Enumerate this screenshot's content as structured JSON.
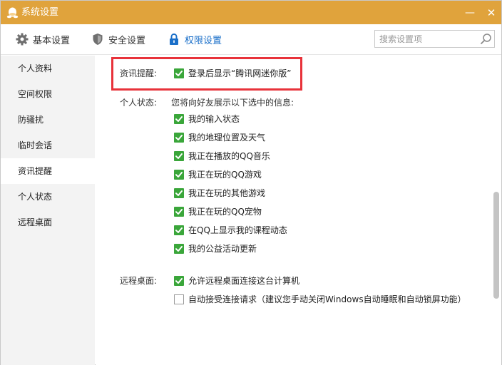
{
  "window": {
    "title": "系统设置",
    "minimize_symbol": "—",
    "close_symbol": "✕"
  },
  "toolbar": {
    "tabs": [
      {
        "label": "基本设置",
        "icon": "gear-icon",
        "active": false
      },
      {
        "label": "安全设置",
        "icon": "shield-icon",
        "active": false
      },
      {
        "label": "权限设置",
        "icon": "lock-icon",
        "active": true
      }
    ],
    "search_placeholder": "搜索设置项",
    "accent_color": "#1a6fc9"
  },
  "sidebar": {
    "items": [
      {
        "label": "个人资料",
        "active": false
      },
      {
        "label": "空间权限",
        "active": false
      },
      {
        "label": "防骚扰",
        "active": false
      },
      {
        "label": "临时会话",
        "active": false
      },
      {
        "label": "资讯提醒",
        "active": true
      },
      {
        "label": "个人状态",
        "active": false
      },
      {
        "label": "远程桌面",
        "active": false
      }
    ]
  },
  "main": {
    "news": {
      "label": "资讯提醒:",
      "option": {
        "text": "登录后显示“腾讯网迷你版”",
        "checked": true
      }
    },
    "status": {
      "label": "个人状态:",
      "description": "您将向好友展示以下选中的信息:",
      "options": [
        {
          "text": "我的输入状态",
          "checked": true
        },
        {
          "text": "我的地理位置及天气",
          "checked": true
        },
        {
          "text": "我正在播放的QQ音乐",
          "checked": true
        },
        {
          "text": "我正在玩的QQ游戏",
          "checked": true
        },
        {
          "text": "我正在玩的其他游戏",
          "checked": true
        },
        {
          "text": "我正在玩的QQ宠物",
          "checked": true
        },
        {
          "text": "在QQ上显示我的课程动态",
          "checked": true
        },
        {
          "text": "我的公益活动更新",
          "checked": true
        }
      ]
    },
    "remote": {
      "label": "远程桌面:",
      "options": [
        {
          "text": "允许远程桌面连接这台计算机",
          "checked": true
        },
        {
          "text": "自动接受连接请求（建议您手动关闭Windows自动睡眠和自动锁屏功能）",
          "checked": false
        }
      ]
    }
  },
  "colors": {
    "titlebar": "#e0a33c",
    "checkbox_checked": "#3aa63a",
    "highlight": "#e8323a"
  }
}
